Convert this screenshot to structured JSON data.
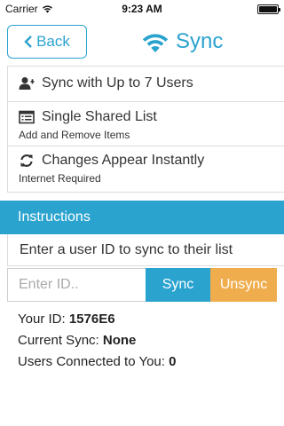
{
  "status_bar": {
    "carrier": "Carrier",
    "time": "9:23 AM",
    "icons": [
      "wifi-icon",
      "battery-icon"
    ]
  },
  "header": {
    "back_label": "Back",
    "title": "Sync",
    "icons": [
      "chevron-left-icon",
      "wifi-icon"
    ]
  },
  "features": [
    {
      "label": "Sync with Up to 7 Users",
      "sub": "",
      "icon": "add-user-icon"
    },
    {
      "label": "Single Shared List",
      "sub": "Add and Remove Items",
      "icon": "list-icon"
    },
    {
      "label": "Changes Appear Instantly",
      "sub": "Internet Required",
      "icon": "refresh-icon"
    }
  ],
  "instructions": {
    "heading": "Instructions",
    "text": "Enter a user ID to sync to their list"
  },
  "form": {
    "id_placeholder": "Enter ID..",
    "id_value": "",
    "sync_label": "Sync",
    "unsync_label": "Unsync"
  },
  "info": {
    "your_id_label": "Your ID:",
    "your_id_value": "1576E6",
    "current_sync_label": "Current Sync:",
    "current_sync_value": "None",
    "connected_label": "Users Connected to You:",
    "connected_value": "0"
  },
  "colors": {
    "accent": "#2aa3cf",
    "warning": "#f0ad4e",
    "border": "#dcdcdc"
  }
}
